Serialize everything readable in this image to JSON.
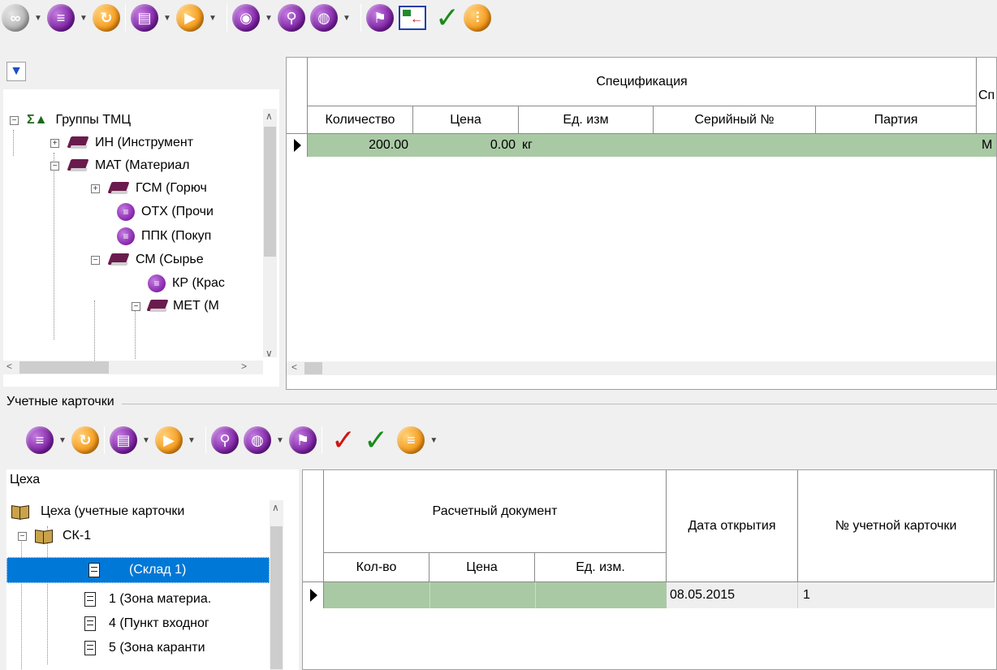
{
  "top_toolbar": {
    "icons": [
      "link-icon",
      "document-icon",
      "refresh-icon",
      "print-icon",
      "play-icon",
      "eye-icon",
      "search-icon",
      "globe-icon",
      "flag-icon",
      "export-window-icon",
      "check-icon",
      "filter-icon"
    ]
  },
  "tree_panel": {
    "filter_icon": "funnel-icon",
    "items": [
      {
        "label": "Группы ТМЦ"
      },
      {
        "label": "ИН (Инструмент"
      },
      {
        "label": "МАТ (Материал"
      },
      {
        "label": "ГСМ (Горюч"
      },
      {
        "label": "ОТХ (Прочи"
      },
      {
        "label": "ППК (Покуп"
      },
      {
        "label": "СМ (Сырье"
      },
      {
        "label": "КР (Крас"
      },
      {
        "label": "МЕТ (М"
      }
    ]
  },
  "spec_grid": {
    "group_header": "Спецификация",
    "cut_header": "Сп",
    "columns": [
      "Количество",
      "Цена",
      "Ед. изм",
      "Серийный №",
      "Партия"
    ],
    "rows": [
      {
        "qty": "200.00",
        "price": "0.00",
        "unit": "кг",
        "serial": "",
        "batch": "",
        "extra": "М"
      }
    ]
  },
  "cards_section": {
    "title": "Учетные карточки",
    "toolbar_icons": [
      "document-icon",
      "refresh-icon",
      "print-icon",
      "play-icon",
      "search-icon",
      "globe-icon",
      "flag-icon",
      "red-check-icon",
      "green-check-icon",
      "orange-document-icon"
    ]
  },
  "workshops_tree": {
    "header": "Цеха",
    "items": [
      {
        "label": "Цеха (учетные карточки"
      },
      {
        "label": "СК-1"
      },
      {
        "label": "(Склад 1)",
        "selected": true
      },
      {
        "label": "1 (Зона материа."
      },
      {
        "label": "4 (Пункт входног"
      },
      {
        "label": "5 (Зона каранти"
      }
    ]
  },
  "cards_grid": {
    "group_header": "Расчетный документ",
    "columns": {
      "qty": "Кол-во",
      "price": "Цена",
      "unit": "Ед. изм.",
      "open_date": "Дата открытия",
      "card_no": "№ учетной карточки"
    },
    "rows": [
      {
        "qty": "",
        "price": "",
        "unit": "",
        "open_date": "08.05.2015",
        "card_no": "1"
      }
    ]
  },
  "colors": {
    "selection": "#0078d7",
    "row_highlight": "#a9c9a4",
    "toolbar_purple": "#7b1fa2",
    "toolbar_orange": "#f59a1b"
  }
}
